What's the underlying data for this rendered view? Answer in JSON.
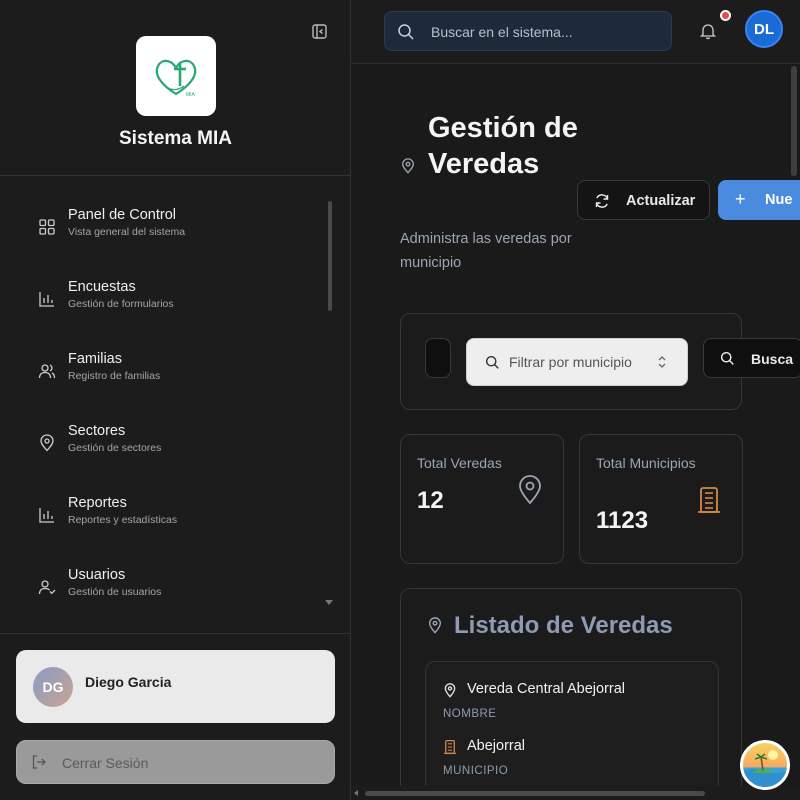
{
  "sidebar": {
    "app_name": "Sistema MIA",
    "logo_text": "MIA",
    "items": [
      {
        "label": "Panel de Control",
        "sub": "Vista general del sistema",
        "icon": "dashboard-icon"
      },
      {
        "label": "Encuestas",
        "sub": "Gestión de formularios",
        "icon": "bar-chart-icon"
      },
      {
        "label": "Familias",
        "sub": "Registro de familias",
        "icon": "users-icon"
      },
      {
        "label": "Sectores",
        "sub": "Gestión de sectores",
        "icon": "map-pin-icon"
      },
      {
        "label": "Reportes",
        "sub": "Reportes y estadísticas",
        "icon": "bar-chart-icon"
      },
      {
        "label": "Usuarios",
        "sub": "Gestión de usuarios",
        "icon": "user-check-icon"
      }
    ],
    "user": {
      "initials": "DG",
      "name": "Diego Garcia"
    },
    "logout_label": "Cerrar Sesión"
  },
  "header": {
    "search_placeholder": "Buscar en el sistema...",
    "avatar_initials": "DL",
    "has_notifications": true
  },
  "main": {
    "title": "Gestión de Veredas",
    "subtitle": "Administra las veredas por municipio",
    "refresh_label": "Actualizar",
    "new_label": "Nue",
    "filter": {
      "municipio_placeholder": "Filtrar por municipio",
      "search_label": "Busca"
    },
    "stats": [
      {
        "label": "Total Veredas",
        "value": "12",
        "icon": "map-pin-icon"
      },
      {
        "label": "Total Municipios",
        "value": "1123",
        "icon": "building-icon"
      }
    ],
    "list": {
      "title": "Listado de Veredas",
      "items": [
        {
          "nombre": "Vereda Central Abejorral",
          "nombre_key": "NOMBRE",
          "municipio": "Abejorral",
          "municipio_key": "MUNICIPIO"
        }
      ]
    }
  },
  "colors": {
    "accent": "#4a8be0",
    "avatar": "#1a6bd6",
    "notification": "#e5484d",
    "building_icon": "#d08a45"
  }
}
